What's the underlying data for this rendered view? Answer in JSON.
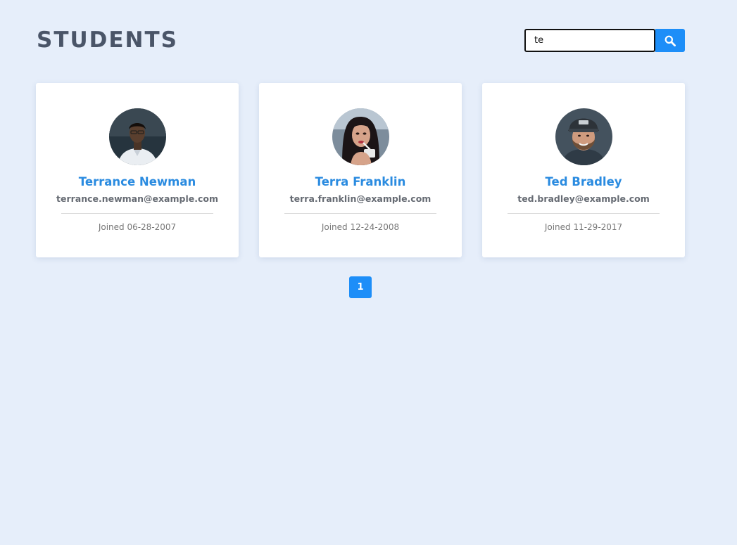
{
  "header": {
    "title": "STUDENTS"
  },
  "search": {
    "value": "te",
    "button_icon": "search-icon"
  },
  "students": [
    {
      "name": "Terrance Newman",
      "email": "terrance.newman@example.com",
      "joined": "Joined 06-28-2007",
      "avatar_icon": "avatar-photo"
    },
    {
      "name": "Terra Franklin",
      "email": "terra.franklin@example.com",
      "joined": "Joined 12-24-2008",
      "avatar_icon": "avatar-photo"
    },
    {
      "name": "Ted Bradley",
      "email": "ted.bradley@example.com",
      "joined": "Joined 11-29-2017",
      "avatar_icon": "avatar-photo"
    }
  ],
  "pagination": {
    "pages": [
      "1"
    ],
    "active": "1"
  },
  "colors": {
    "background": "#e6eefa",
    "accent": "#1d8ef8",
    "name": "#2a8be0",
    "title": "#4a5568"
  }
}
